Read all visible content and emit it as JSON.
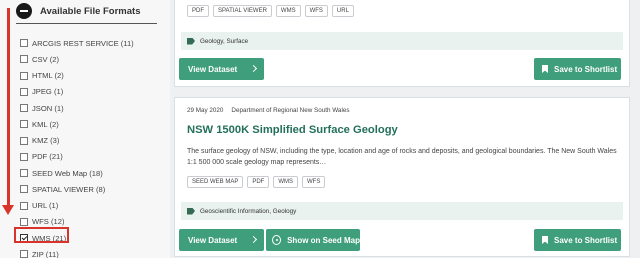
{
  "sidebar": {
    "title": "Available File Formats",
    "formats": [
      {
        "label": "ARCGIS REST SERVICE (11)",
        "checked": false
      },
      {
        "label": "CSV (2)",
        "checked": false
      },
      {
        "label": "HTML (2)",
        "checked": false
      },
      {
        "label": "JPEG (1)",
        "checked": false
      },
      {
        "label": "JSON (1)",
        "checked": false
      },
      {
        "label": "KML (2)",
        "checked": false
      },
      {
        "label": "KMZ (3)",
        "checked": false
      },
      {
        "label": "PDF (21)",
        "checked": false
      },
      {
        "label": "SEED Web Map (18)",
        "checked": false
      },
      {
        "label": "SPATIAL VIEWER (8)",
        "checked": false
      },
      {
        "label": "URL (1)",
        "checked": false
      },
      {
        "label": "WFS (12)",
        "checked": false
      },
      {
        "label": "WMS (21)",
        "checked": true
      },
      {
        "label": "ZIP (11)",
        "checked": false
      }
    ],
    "annotation_color": "#d9342b"
  },
  "card1": {
    "tags": [
      "PDF",
      "SPATIAL VIEWER",
      "WMS",
      "WFS",
      "URL"
    ],
    "categories": "Geology, Surface",
    "view_label": "View Dataset",
    "shortlist_label": "Save to Shortlist"
  },
  "card2": {
    "date": "29 May 2020",
    "org": "Department of Regional New South Wales",
    "title": "NSW 1500K Simplified Surface Geology",
    "description": "The surface geology of NSW, including the type, location and age of rocks and deposits, and geological boundaries. The New South Wales 1:1 500 000 scale geology map represents…",
    "tags": [
      "SEED WEB MAP",
      "PDF",
      "WMS",
      "WFS"
    ],
    "categories": "Geoscientific Information, Geology",
    "view_label": "View Dataset",
    "seed_map_label": "Show on Seed Map",
    "shortlist_label": "Save to Shortlist"
  },
  "colors": {
    "accent": "#3f9e7c",
    "title": "#23705a",
    "category_bg": "#e9f2ee"
  }
}
